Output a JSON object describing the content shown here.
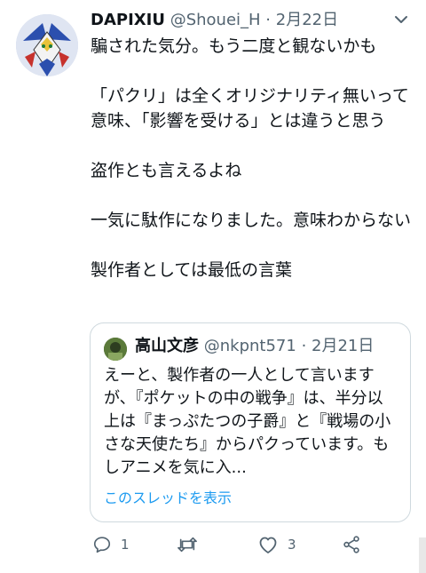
{
  "tweet": {
    "author_name": "DAPIXIU",
    "author_handle": "@Shouei_H",
    "separator": "·",
    "date": "2月22日",
    "text": "騙された気分。もう二度と観ないかも\n\n「パクリ」は全くオリジナリティ無いって意味、「影響を受ける」とは違うと思う\n\n盗作とも言えるよね\n\n一気に駄作になりました。意味わからない\n\n製作者としては最低の言葉"
  },
  "quote": {
    "author_name": "高山文彦",
    "author_handle": "@nkpnt571",
    "separator": "·",
    "date": "2月21日",
    "text": "えーと、製作者の一人として言いますが、『ポケットの中の戦争』は、半分以上は『まっぷたつの子爵』と『戦場の小さな天使たち』からパクっています。もしアニメを気に入...",
    "show_thread": "このスレッドを表示"
  },
  "actions": {
    "reply_count": "1",
    "retweet_count": "",
    "like_count": "3"
  },
  "icons": {
    "more": "more-chevron-icon",
    "reply": "reply-icon",
    "retweet": "retweet-icon",
    "like": "heart-icon",
    "share": "share-icon"
  },
  "colors": {
    "text": "#0f1419",
    "secondary": "#536471",
    "link": "#1d9bf0",
    "border": "#cfd9de"
  }
}
